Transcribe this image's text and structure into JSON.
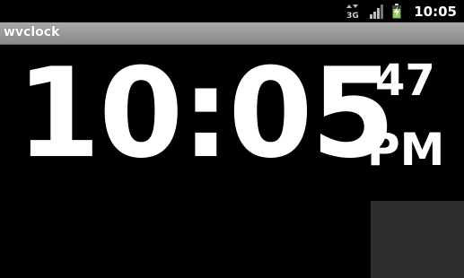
{
  "status_bar": {
    "network_label": "3G",
    "time": "10:05",
    "icons": [
      "network-3g-icon",
      "signal-strength-icon",
      "battery-charging-icon"
    ],
    "battery_color": "#8fd14f"
  },
  "title_bar": {
    "title": "wvclock"
  },
  "clock": {
    "time": "10:05",
    "seconds": "47",
    "ampm": "PM"
  },
  "colors": {
    "background": "#000000",
    "text": "#ffffff",
    "title_bar": "#9a9a9a",
    "corner_panel": "#2e2e2e"
  }
}
